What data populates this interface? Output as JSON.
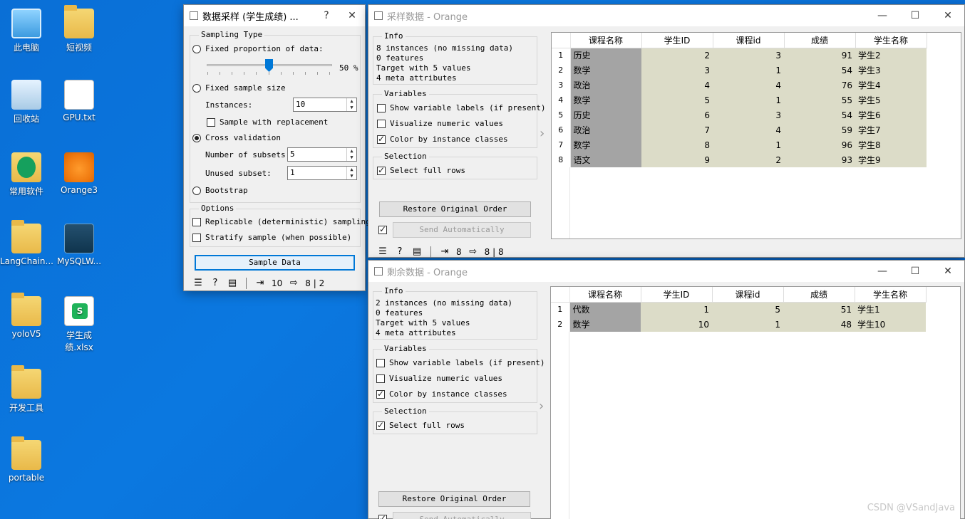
{
  "desktop": {
    "icons": [
      {
        "label": "此电脑",
        "icon": "computer-icon"
      },
      {
        "label": "短视频",
        "icon": "folder-icon"
      },
      {
        "label": "回收站",
        "icon": "recycle-bin-icon"
      },
      {
        "label": "GPU.txt",
        "icon": "text-file-icon"
      },
      {
        "label": "常用软件",
        "icon": "folder-icon"
      },
      {
        "label": "Orange3",
        "icon": "orange-app-icon"
      },
      {
        "label": "LangChain...",
        "icon": "folder-icon"
      },
      {
        "label": "MySQLW...",
        "icon": "mysql-icon"
      },
      {
        "label": "yoloV5",
        "icon": "folder-icon"
      },
      {
        "label": "学生成绩.xlsx",
        "icon": "spreadsheet-icon"
      },
      {
        "label": "开发工具",
        "icon": "folder-icon"
      },
      {
        "label": "portable",
        "icon": "folder-icon"
      }
    ]
  },
  "sampler": {
    "title": "数据采样 (学生成绩) ...",
    "help_btn": "?",
    "close_btn": "✕",
    "sampling_type": {
      "title": "Sampling Type",
      "fixed_proportion": "Fixed proportion of data:",
      "proportion_value": "50 %",
      "proportion": 50,
      "fixed_size": "Fixed sample size",
      "instances_label": "Instances:",
      "instances_value": "10",
      "replacement": "Sample with replacement",
      "cross_validation": "Cross validation",
      "subsets_label": "Number of subsets:",
      "subsets_value": "5",
      "unused_label": "Unused subset:",
      "unused_value": "1",
      "bootstrap": "Bootstrap"
    },
    "options": {
      "title": "Options",
      "replicable": "Replicable (deterministic) sampling",
      "stratify": "Stratify sample (when possible)"
    },
    "sample_button": "Sample Data",
    "status": {
      "in": "10",
      "out": "8 | 2"
    }
  },
  "table1": {
    "title": "采样数据 - Orange",
    "info": {
      "title": "Info",
      "lines": [
        "8 instances (no missing data)",
        "0  features",
        "Target with 5 values",
        "4 meta attributes"
      ]
    },
    "variables": {
      "title": "Variables",
      "show_labels": "Show variable labels (if present)",
      "visualize": "Visualize numeric values",
      "color": "Color by instance classes"
    },
    "selection": {
      "title": "Selection",
      "full_rows": "Select full rows"
    },
    "restore_button": "Restore Original Order",
    "send_button": "Send Automatically",
    "status": {
      "in": "8",
      "out": "8 | 8"
    },
    "columns": [
      "课程名称",
      "学生ID",
      "课程id",
      "成绩",
      "学生名称"
    ],
    "rows": [
      [
        "1",
        "历史",
        "2",
        "3",
        "91",
        "学生2"
      ],
      [
        "2",
        "数学",
        "3",
        "1",
        "54",
        "学生3"
      ],
      [
        "3",
        "政治",
        "4",
        "4",
        "76",
        "学生4"
      ],
      [
        "4",
        "数学",
        "5",
        "1",
        "55",
        "学生5"
      ],
      [
        "5",
        "历史",
        "6",
        "3",
        "54",
        "学生6"
      ],
      [
        "6",
        "政治",
        "7",
        "4",
        "59",
        "学生7"
      ],
      [
        "7",
        "数学",
        "8",
        "1",
        "96",
        "学生8"
      ],
      [
        "8",
        "语文",
        "9",
        "2",
        "93",
        "学生9"
      ]
    ]
  },
  "table2": {
    "title": "剩余数据 - Orange",
    "info": {
      "title": "Info",
      "lines": [
        "2 instances (no missing data)",
        "0  features",
        "Target with 5 values",
        "4 meta attributes"
      ]
    },
    "variables": {
      "title": "Variables",
      "show_labels": "Show variable labels (if present)",
      "visualize": "Visualize numeric values",
      "color": "Color by instance classes"
    },
    "selection": {
      "title": "Selection",
      "full_rows": "Select full rows"
    },
    "restore_button": "Restore Original Order",
    "send_button": "Send Automatically",
    "columns": [
      "课程名称",
      "学生ID",
      "课程id",
      "成绩",
      "学生名称"
    ],
    "rows": [
      [
        "1",
        "代数",
        "1",
        "5",
        "51",
        "学生1"
      ],
      [
        "2",
        "数学",
        "10",
        "1",
        "48",
        "学生10"
      ]
    ]
  },
  "watermark": "CSDN @VSandJava"
}
